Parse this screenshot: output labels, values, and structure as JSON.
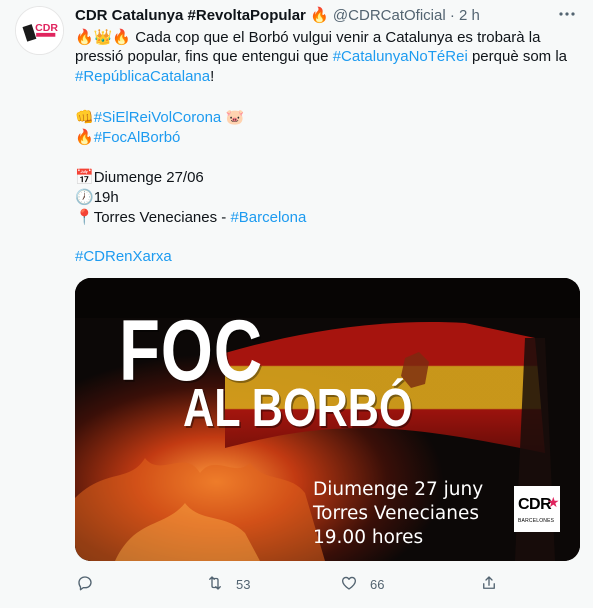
{
  "tweet": {
    "display_name": "CDR Catalunya #RevoltaPopular",
    "name_emoji": "🔥",
    "handle": "@CDRCatOficial",
    "separator": "·",
    "time": "2 h",
    "avatar_text": "CDR"
  },
  "body": {
    "line1_emojis": "🔥👑🔥",
    "line1_text": " Cada cop que el Borbó vulgui venir a Catalunya es trobarà la",
    "line2_text": "pressió popular, fins que entengui que ",
    "line2_link": "#CatalunyaNoTéRei",
    "line2_tail": " perquè som la",
    "line3_link": "#RepúblicaCatalana",
    "line3_tail": "!",
    "hashtag1_emoji": "👊",
    "hashtag1": "#SiElReiVolCorona",
    "hashtag1_tail_emoji": "🐷",
    "hashtag2_emoji": "🔥",
    "hashtag2": "#FocAlBorbó",
    "date_emoji": "📅",
    "date": "Diumenge 27/06",
    "time_emoji": "🕖",
    "time": "19h",
    "place_emoji": "📍",
    "place": "Torres Venecianes - ",
    "place_link": "#Barcelona",
    "footer_hashtag": "#CDRenXarxa"
  },
  "media": {
    "title_line1": "FOC",
    "title_line2": "AL BORBÓ",
    "info_line1": "Diumenge 27 juny",
    "info_line2": "Torres Venecianes",
    "info_line3": "19.00 hores",
    "logo_text": "CDR",
    "logo_sub": "BARCELONES"
  },
  "actions": {
    "reply_count": "",
    "retweet_count": "53",
    "like_count": "66",
    "share_count": ""
  },
  "colors": {
    "link": "#1d9bf0",
    "text": "#0f1419",
    "secondary": "#536471",
    "background": "#f7f9f9"
  },
  "icons": [
    "reply-icon",
    "retweet-icon",
    "like-icon",
    "share-icon",
    "more-icon"
  ]
}
